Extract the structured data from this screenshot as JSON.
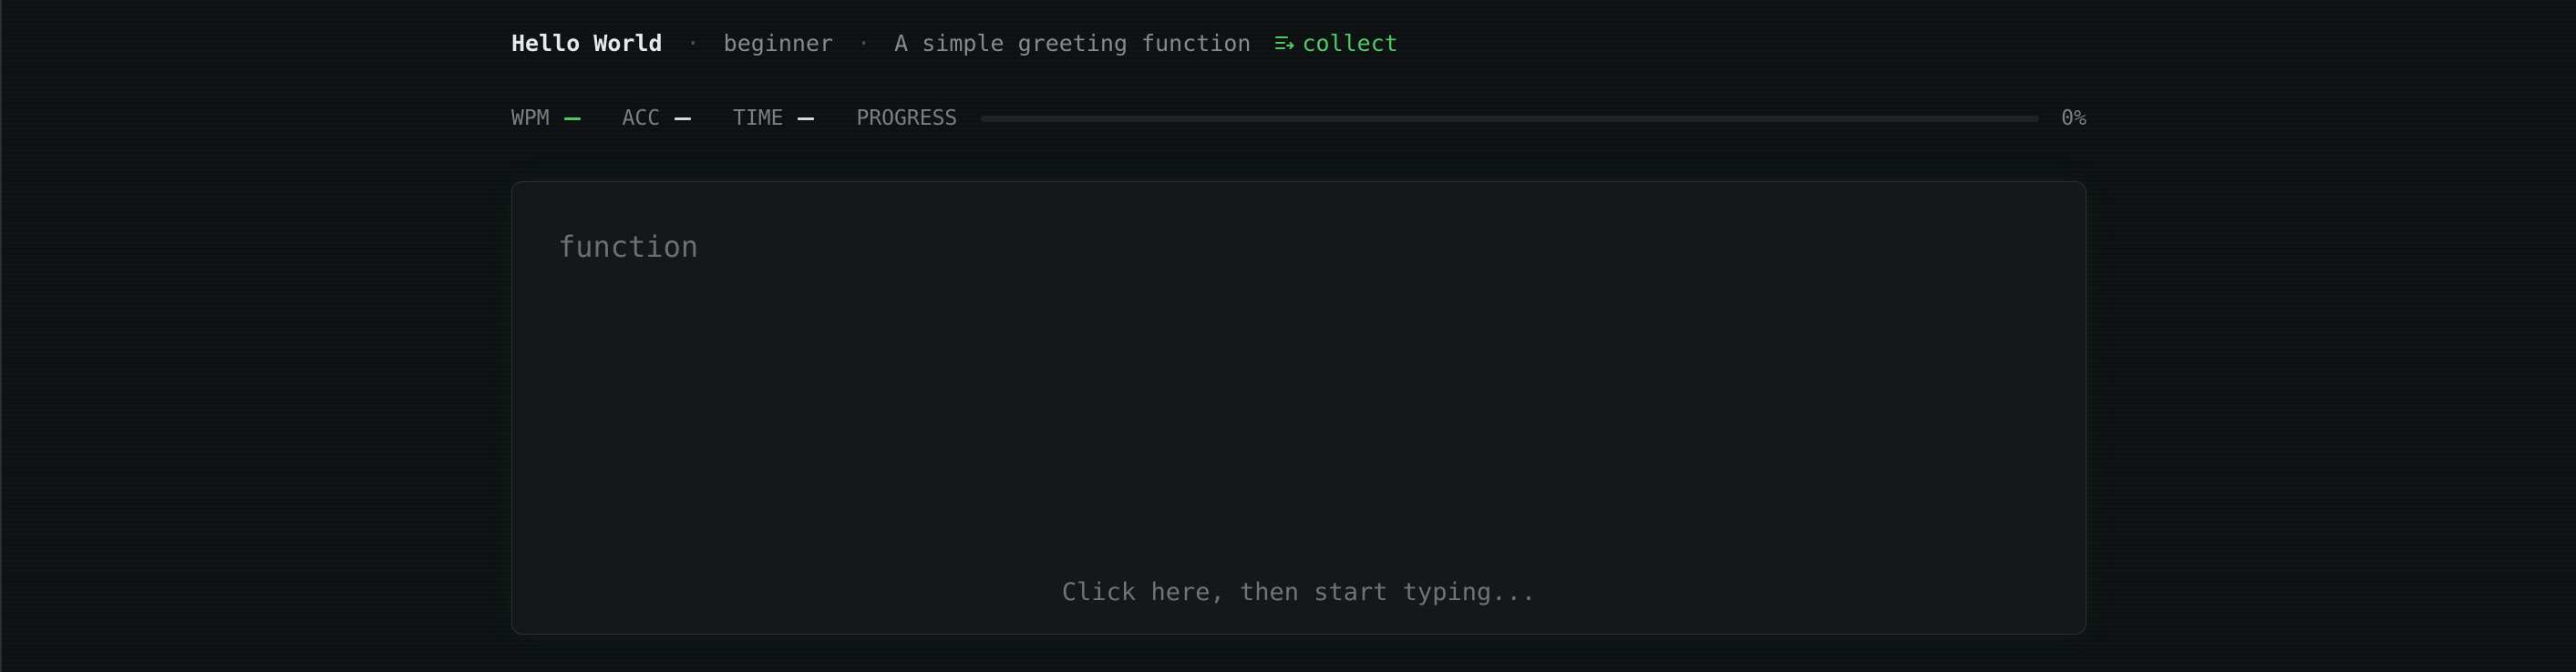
{
  "header": {
    "title": "Hello World",
    "separator": "·",
    "level": "beginner",
    "description": "A simple greeting function",
    "collect_label": "collect",
    "collect_icon": "playlist-add-icon"
  },
  "stats": {
    "wpm_label": "WPM",
    "acc_label": "ACC",
    "time_label": "TIME",
    "progress_label": "PROGRESS",
    "progress_value": 0,
    "progress_text": "0%"
  },
  "editor": {
    "code": "function",
    "hint": "Click here, then start typing..."
  },
  "colors": {
    "accent": "#4fc866",
    "dash_neutral": "#d4d7db",
    "background": "#0d1112",
    "panel": "#15171b"
  }
}
